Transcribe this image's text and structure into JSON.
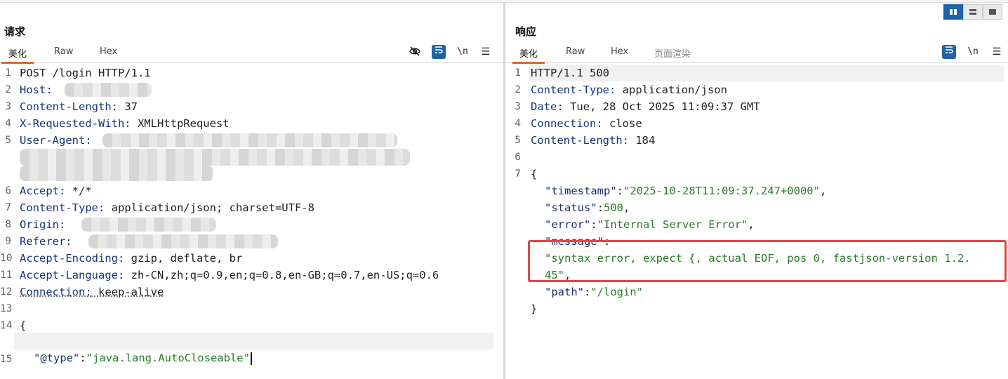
{
  "request": {
    "title": "请求",
    "tabs": [
      "美化",
      "Raw",
      "Hex"
    ],
    "tools": {
      "hide_icon": "eye-off-icon",
      "wrap_icon": "wrap-lines-icon",
      "newline": "\\n",
      "menu": "☰"
    },
    "lines": [
      {
        "n": "1",
        "k": "POST /login HTTP/1.1",
        "v": ""
      },
      {
        "n": "2",
        "k": "Host:",
        "v": ""
      },
      {
        "n": "3",
        "k": "Content-Length:",
        "v": " 37"
      },
      {
        "n": "4",
        "k": "X-Requested-With:",
        "v": " XMLHttpRequest"
      },
      {
        "n": "5",
        "k": "User-Agent:",
        "v": ""
      },
      {
        "n": "6",
        "k": "Accept:",
        "v": " */*"
      },
      {
        "n": "7",
        "k": "Content-Type:",
        "v": " application/json; charset=UTF-8"
      },
      {
        "n": "8",
        "k": "Origin:",
        "v": ""
      },
      {
        "n": "9",
        "k": "Referer:",
        "v": ""
      },
      {
        "n": "10",
        "k": "Accept-Encoding:",
        "v": " gzip, deflate, br"
      },
      {
        "n": "11",
        "k": "Accept-Language:",
        "v": " zh-CN,zh;q=0.9,en;q=0.8,en-GB;q=0.7,en-US;q=0.6"
      },
      {
        "n": "12",
        "k": "Connection:",
        "v": " keep-alive"
      },
      {
        "n": "13",
        "k": "",
        "v": ""
      },
      {
        "n": "14",
        "k": "{",
        "v": ""
      },
      {
        "n": "15",
        "k": "",
        "v": ""
      }
    ],
    "body_key": "\"@type\"",
    "body_sep": ":",
    "body_val": "\"java.lang.AutoCloseable\""
  },
  "response": {
    "title": "响应",
    "tabs": [
      "美化",
      "Raw",
      "Hex",
      "页面渲染"
    ],
    "tools": {
      "wrap_icon": "wrap-lines-icon",
      "newline": "\\n",
      "menu": "☰"
    },
    "layout_buttons": [
      "split-columns-icon",
      "split-rows-icon",
      "single-pane-icon"
    ],
    "lines": [
      {
        "n": "1",
        "k": "HTTP/1.1 500",
        "v": ""
      },
      {
        "n": "2",
        "k": "Content-Type:",
        "v": " application/json"
      },
      {
        "n": "3",
        "k": "Date:",
        "v": " Tue, 28 Oct 2025 11:09:37 GMT"
      },
      {
        "n": "4",
        "k": "Connection:",
        "v": " close"
      },
      {
        "n": "5",
        "k": "Content-Length:",
        "v": " 184"
      },
      {
        "n": "6",
        "k": "",
        "v": ""
      },
      {
        "n": "7",
        "k": "{",
        "v": ""
      }
    ],
    "json": {
      "timestamp_key": "\"timestamp\"",
      "timestamp_val": "\"2025-10-28T11:09:37.247+0000\"",
      "status_key": "\"status\"",
      "status_val": "500",
      "error_key": "\"error\"",
      "error_val": "\"Internal Server Error\"",
      "message_key": "\"message\"",
      "message_val_1": "\"syntax error, expect {, actual EOF, pos 0, fastjson-version 1.2.",
      "message_val_2": "45\"",
      "path_key": "\"path\"",
      "path_val": "\"/login\"",
      "close": "}"
    }
  },
  "colors": {
    "accent_tab": "#e8622c",
    "wrap_button": "#1f62a8",
    "highlight_box": "#e04848"
  }
}
